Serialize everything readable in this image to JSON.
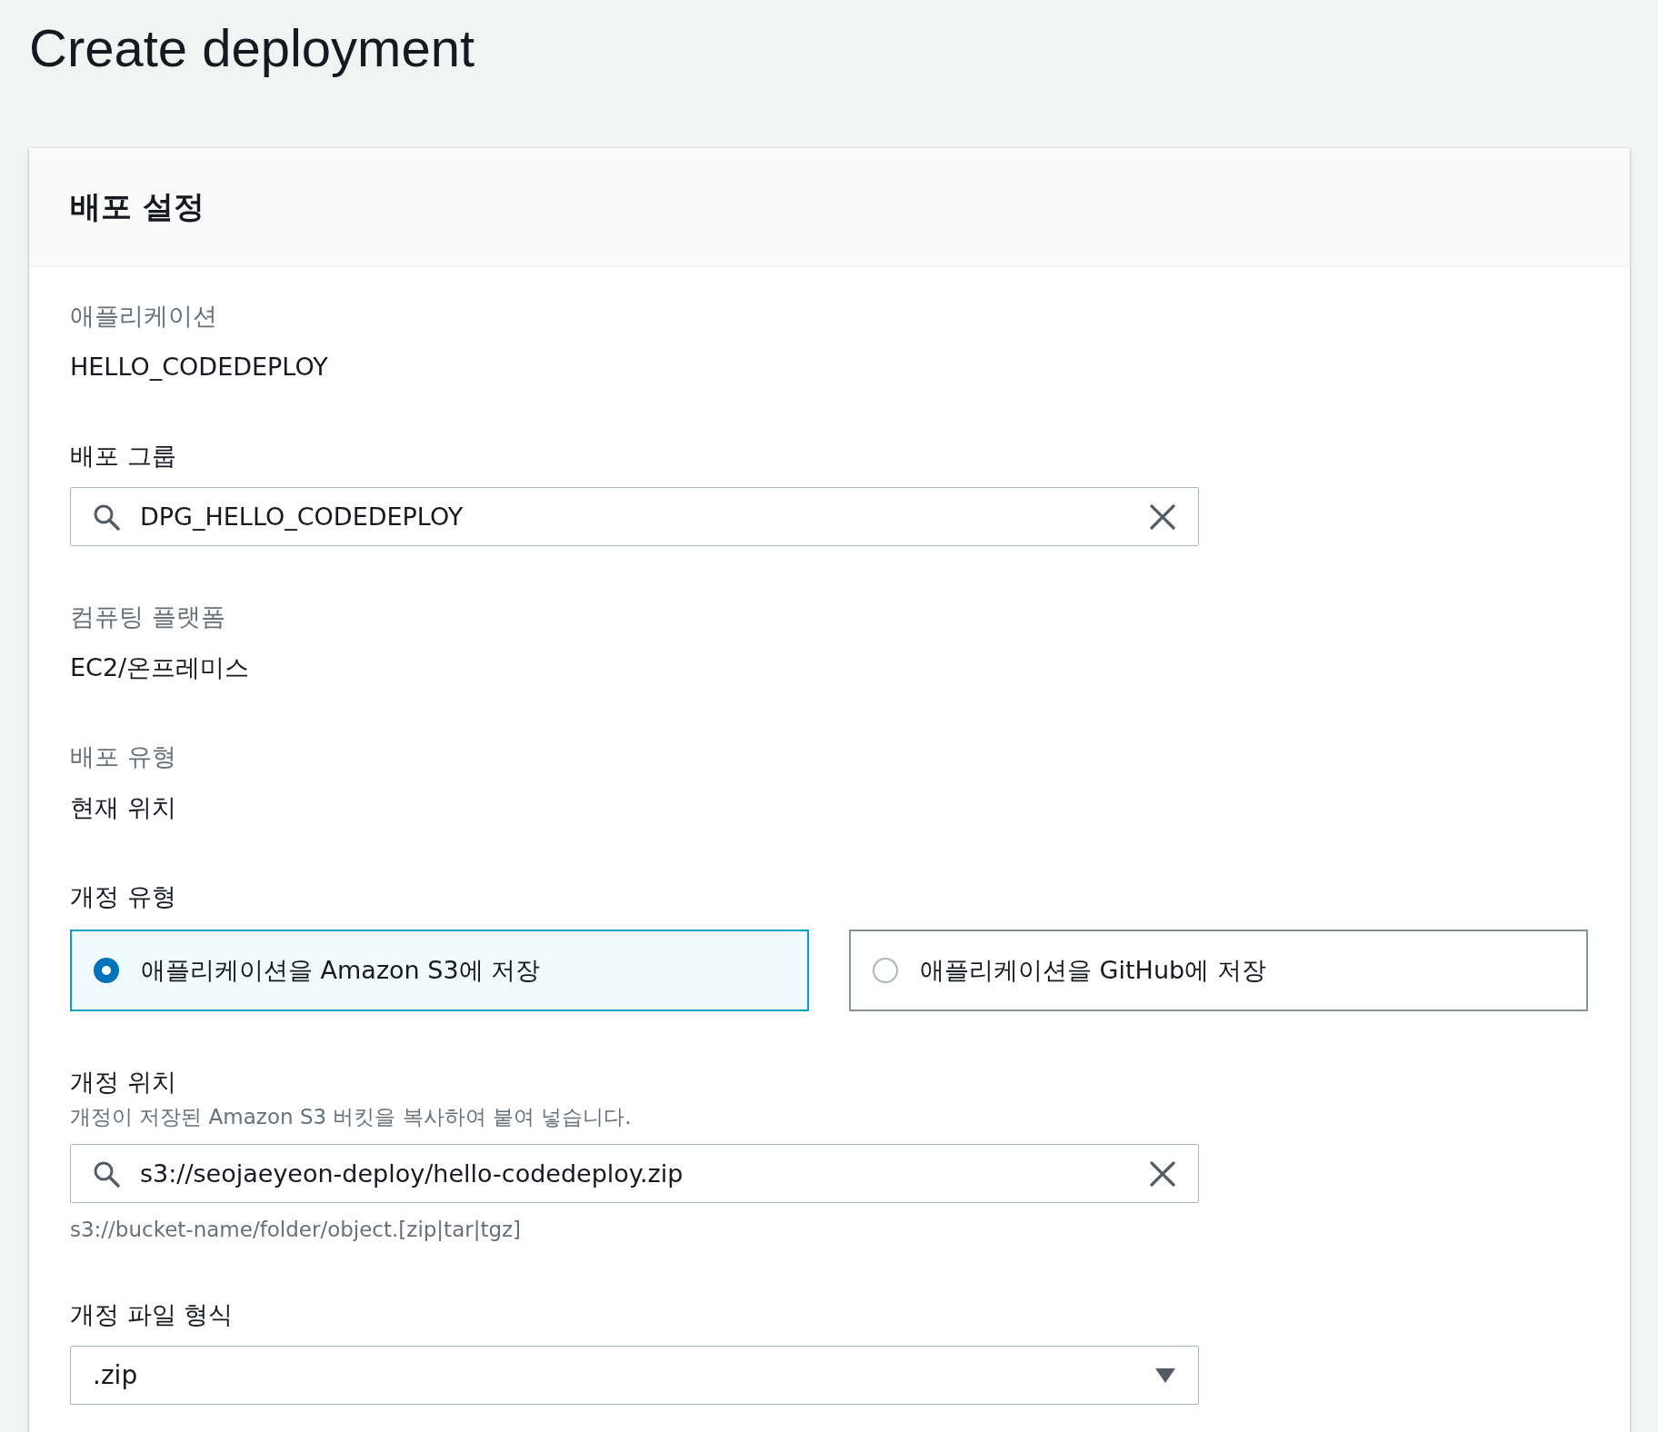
{
  "page_title": "Create deployment",
  "panel": {
    "title": "배포 설정",
    "fields": [
      {
        "kind": "static",
        "label": "애플리케이션",
        "value": "HELLO_CODEDEPLOY"
      },
      {
        "kind": "search",
        "label": "배포 그룹",
        "value": "DPG_HELLO_CODEDEPLOY"
      },
      {
        "kind": "static",
        "label": "컴퓨팅 플랫폼",
        "value": "EC2/온프레미스"
      },
      {
        "kind": "static",
        "label": "배포 유형",
        "value": "현재 위치"
      },
      {
        "kind": "radio",
        "label": "개정 유형",
        "options": [
          {
            "label": "애플리케이션을 Amazon S3에 저장",
            "selected": true
          },
          {
            "label": "애플리케이션을 GitHub에 저장",
            "selected": false
          }
        ]
      },
      {
        "kind": "search",
        "label": "개정 위치",
        "description": "개정이 저장된 Amazon S3 버킷을 복사하여 붙여 넣습니다.",
        "value": "s3://seojaeyeon-deploy/hello-codedeploy.zip",
        "hint": "s3://bucket-name/folder/object.[zip|tar|tgz]"
      },
      {
        "kind": "select",
        "label": "개정 파일 형식",
        "value": ".zip"
      }
    ]
  }
}
